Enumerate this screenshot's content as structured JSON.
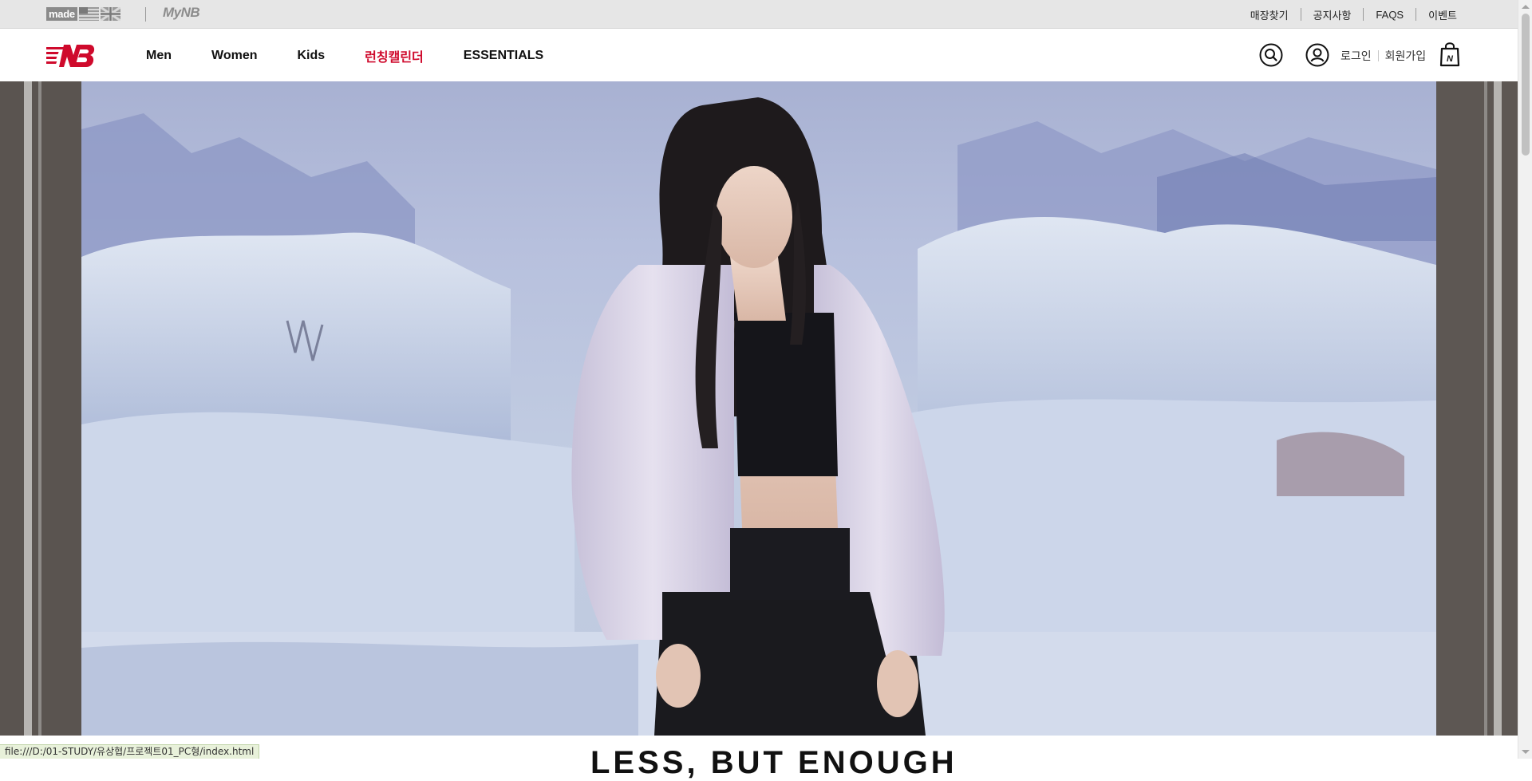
{
  "utility": {
    "made_label": "made",
    "mynb_label": "MyNB",
    "links": [
      "매장찾기",
      "공지사항",
      "FAQS",
      "이벤트"
    ]
  },
  "nav": {
    "items": [
      {
        "label": "Men",
        "highlight": false
      },
      {
        "label": "Women",
        "highlight": false
      },
      {
        "label": "Kids",
        "highlight": false
      },
      {
        "label": "런칭캘린더",
        "highlight": true
      },
      {
        "label": "ESSENTIALS",
        "highlight": false
      }
    ],
    "login_label": "로그인",
    "signup_label": "회원가입",
    "icons": [
      "search-icon",
      "user-icon",
      "shopping-bag-icon"
    ]
  },
  "hero": {
    "description": "hero-image"
  },
  "below_heading": "LESS, BUT ENOUGH",
  "status_bar": {
    "url": "file:///D:/01-STUDY/유상협/프로젝트01_PC형/index.html"
  },
  "colors": {
    "brand_red": "#cf0a2c",
    "utility_bg": "#e6e6e6",
    "text_dark": "#111111"
  }
}
